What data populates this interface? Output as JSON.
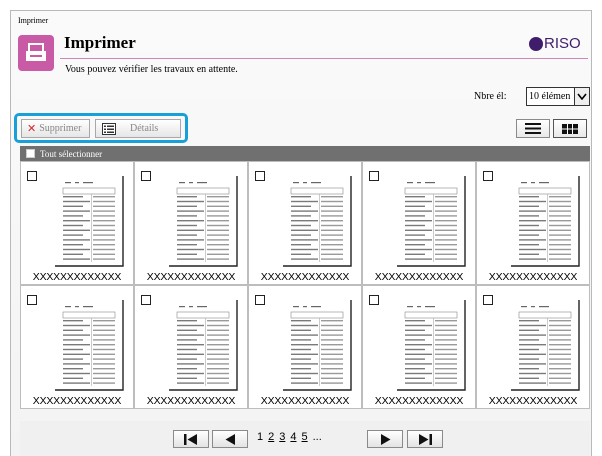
{
  "breadcrumb": "Imprimer",
  "header": {
    "title": "Imprimer",
    "subtitle": "Vous pouvez vérifier les travaux en attente.",
    "logo_text": "RISO",
    "accent_color": "#c85aa6"
  },
  "per_page": {
    "label": "Nbre él:",
    "value": "10 élémen"
  },
  "toolbar": {
    "delete_label": "Supprimer",
    "details_label": "Détails",
    "highlight_color": "#1aa0d8"
  },
  "select_all_label": "Tout sélectionner",
  "jobs": [
    {
      "name": "XXXXXXXXXXXXX"
    },
    {
      "name": "XXXXXXXXXXXXX"
    },
    {
      "name": "XXXXXXXXXXXXX"
    },
    {
      "name": "XXXXXXXXXXXXX"
    },
    {
      "name": "XXXXXXXXXXXXX"
    },
    {
      "name": "XXXXXXXXXXXXX"
    },
    {
      "name": "XXXXXXXXXXXXX"
    },
    {
      "name": "XXXXXXXXXXXXX"
    },
    {
      "name": "XXXXXXXXXXXXX"
    },
    {
      "name": "XXXXXXXXXXXXX"
    }
  ],
  "pagination": {
    "current": "1",
    "pages": [
      "2",
      "3",
      "4",
      "5"
    ],
    "ellipsis": "..."
  }
}
